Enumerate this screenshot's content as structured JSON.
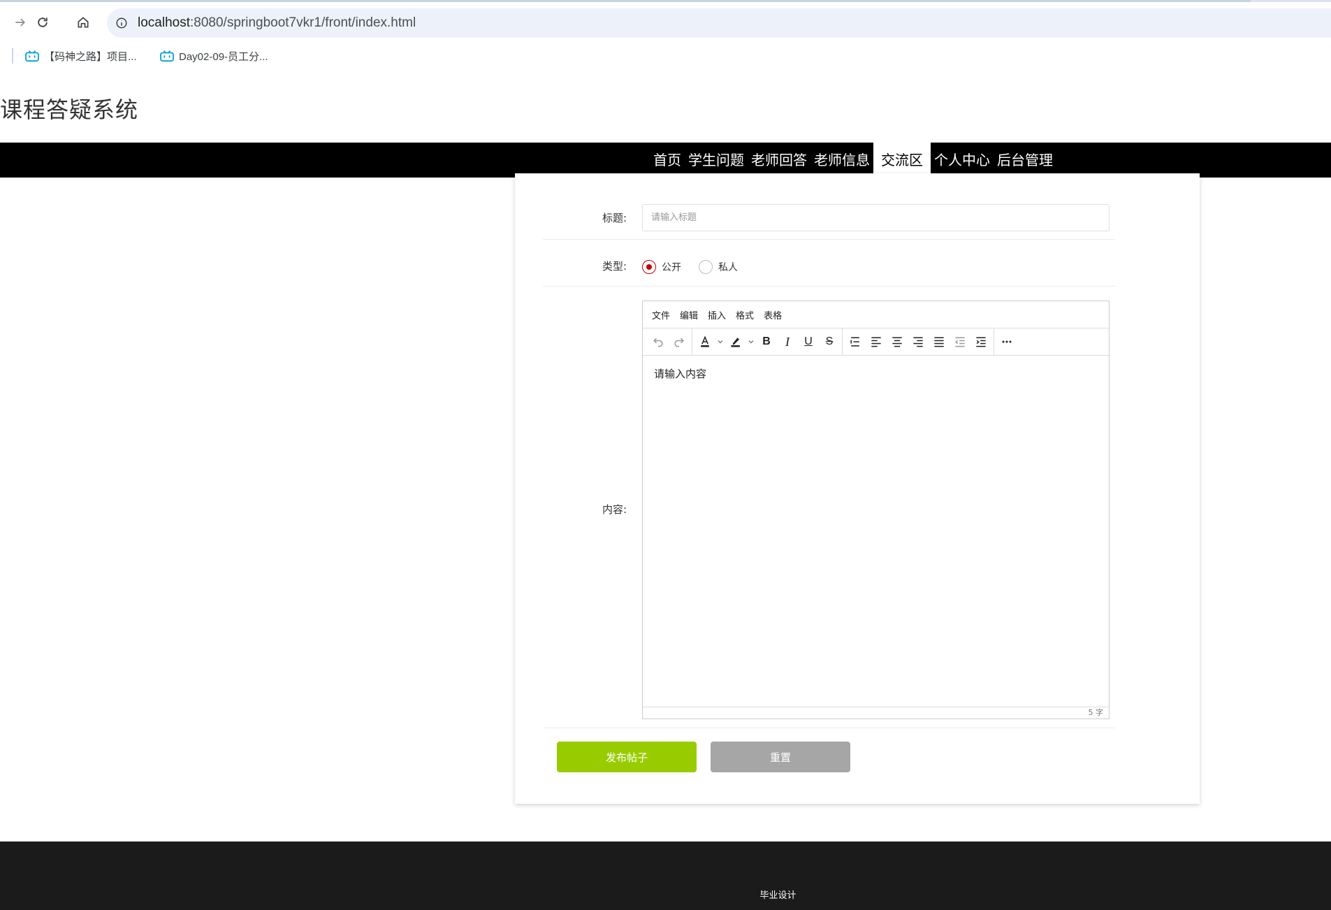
{
  "browser": {
    "url_host": "localhost",
    "url_rest": ":8080/springboot7vkr1/front/index.html",
    "bookmarks": [
      {
        "label": "【码神之路】项目..."
      },
      {
        "label": "Day02-09-员工分..."
      }
    ]
  },
  "site": {
    "title": "课程答疑系统"
  },
  "nav": {
    "items": [
      {
        "label": "首页"
      },
      {
        "label": "学生问题"
      },
      {
        "label": "老师回答"
      },
      {
        "label": "老师信息"
      },
      {
        "label": "交流区"
      },
      {
        "label": "个人中心"
      },
      {
        "label": "后台管理"
      }
    ],
    "active_index": 4
  },
  "form": {
    "title_label": "标题:",
    "title_placeholder": "请输入标题",
    "title_value": "",
    "type_label": "类型:",
    "type_options": [
      {
        "label": "公开",
        "checked": true
      },
      {
        "label": "私人",
        "checked": false
      }
    ],
    "content_label": "内容:",
    "editor": {
      "menus": [
        "文件",
        "编辑",
        "插入",
        "格式",
        "表格"
      ],
      "content": "请输入内容",
      "word_count": "5 字"
    },
    "publish_label": "发布帖子",
    "reset_label": "重置"
  },
  "footer": {
    "text": "毕业设计"
  },
  "colors": {
    "nav_bg": "#000000",
    "publish_btn": "#99cc00",
    "reset_btn": "#a6a6a6",
    "radio_checked": "#c80000",
    "footer_bg": "#1b1b1b"
  }
}
